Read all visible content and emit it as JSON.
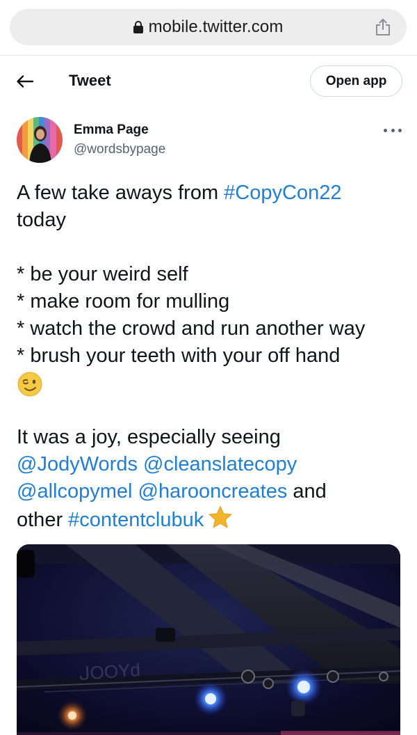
{
  "browser": {
    "url": "mobile.twitter.com"
  },
  "nav": {
    "title": "Tweet",
    "open_app_label": "Open app"
  },
  "author": {
    "name": "Emma Page",
    "handle": "@wordsbypage"
  },
  "tweet": {
    "l1_text": "A few take aways from ",
    "l1_tag": "#CopyCon22",
    "l2": "today",
    "b1": "* be your weird self",
    "b2": "* make room for mulling",
    "b3": "* watch the crowd and run another way",
    "b4": "* brush your teeth with your off hand",
    "l8": "It was a joy, especially seeing",
    "m1": "@JodyWords",
    "m2": "@cleanslatecopy",
    "m3": "@allcopymel",
    "m4": "@harooncreates",
    "and_text": " and",
    "other_text": "other ",
    "tag2": "#contentclubuk"
  },
  "icons": {
    "lock": "lock-icon",
    "share": "share-icon",
    "back": "back-arrow-icon",
    "more": "more-icon",
    "wink": "winking-face-emoji",
    "star": "star-emoji"
  },
  "colors": {
    "link": "#1d7fd8",
    "text": "#0f1419",
    "secondary": "#536471",
    "star": "#f5b52b"
  }
}
